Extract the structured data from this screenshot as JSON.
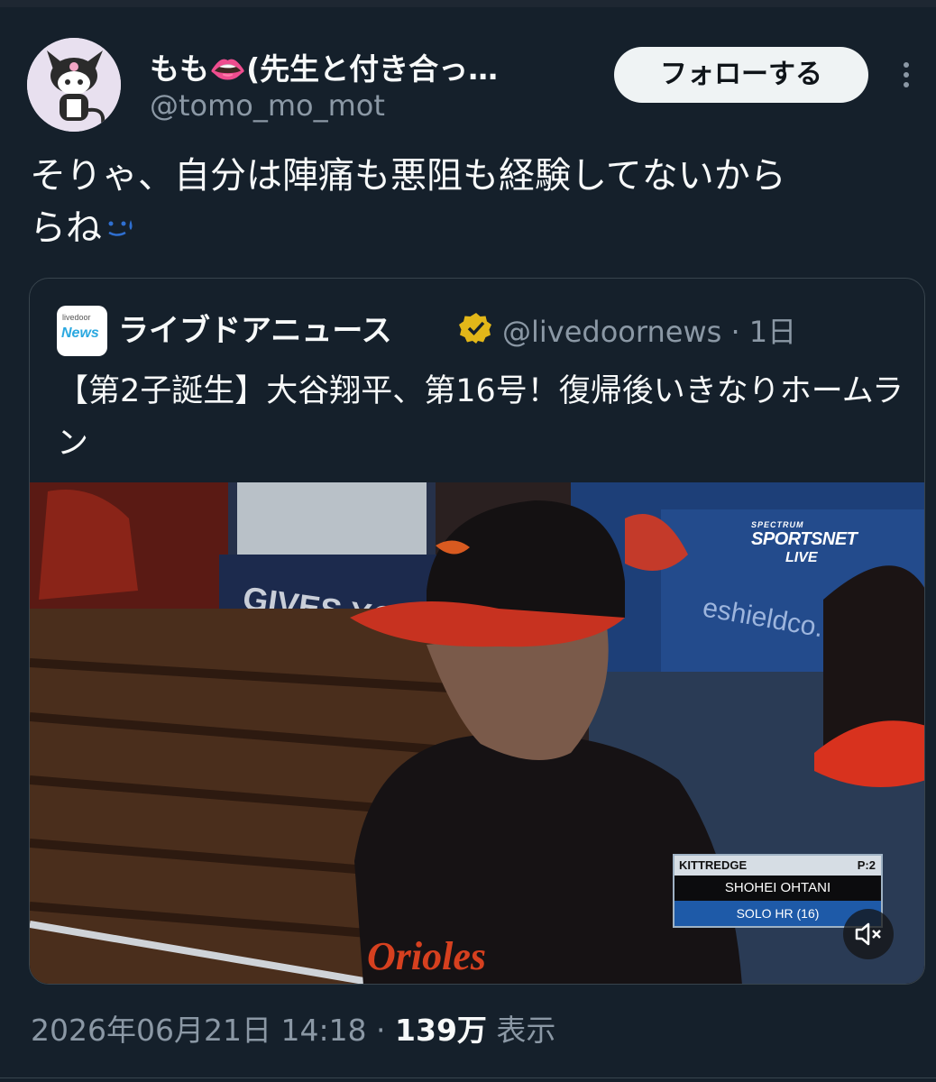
{
  "author": {
    "display_name": "もも👄(先生と付き合っ…",
    "handle": "@tomo_mo_mot",
    "avatar_icon": "kuromi-avatar-icon"
  },
  "actions": {
    "follow_label": "フォローする",
    "more_icon": "more-vertical-icon"
  },
  "post": {
    "text_main": "そりゃ、自分は陣痛も悪阻も経験してないから",
    "text_tail": "らね"
  },
  "quoted": {
    "source_name": "ライブドアニュース",
    "handle_time": "@livedoornews · 1日",
    "logo_line1": "livedoor",
    "logo_line2": "News",
    "text": "【第2子誕生】大谷翔平、第16号！復帰後いきなりホームラン",
    "video": {
      "broadcaster_top": "SPECTRUM",
      "broadcaster_name": "SPORTSNET",
      "broadcaster_live": "LIVE",
      "banner_text": "GIVES YOU",
      "wall_text": "eshieldco.",
      "pitcher_label": "KITTREDGE",
      "pitch_count": "P:2",
      "batter_name": "SHOHEI OHTANI",
      "play_result": "SOLO HR (16)"
    }
  },
  "meta": {
    "timestamp": "2026年06月21日 14:18 · ",
    "views": "139万",
    "views_label": " 表示"
  },
  "colors": {
    "background": "#15202b",
    "text_primary": "#f7f9f9",
    "text_secondary": "#8b98a5",
    "border": "#38444d",
    "follow_button_bg": "#eff3f4",
    "verified_gold": "#e2b719"
  }
}
